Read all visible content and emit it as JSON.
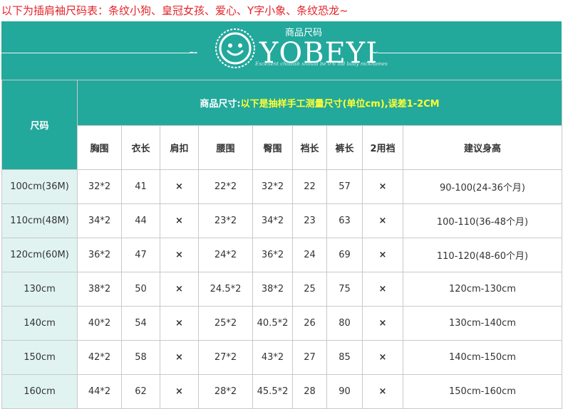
{
  "title": "以下为插肩袖尺码表：条纹小狗、皇冠女孩、爱心、Y字小象、条纹恐龙~",
  "banner": {
    "brand_small": "商品尺码",
    "brand": "YOBEYI",
    "slogan": "Excellent childish should be 0-6 old baby nicknames",
    "logo_icon": "smiley-badge-icon",
    "color": "#23a89c"
  },
  "table": {
    "size_header": "尺码",
    "caption_prefix": "商品尺寸:",
    "caption_note": "以下是抽样手工测量尺寸(单位cm),误差1-2CM",
    "columns": [
      "胸围",
      "衣长",
      "肩扣",
      "腰围",
      "臀围",
      "裆长",
      "裤长",
      "2用裆",
      "建议身高"
    ],
    "x_mark": "×",
    "rows": [
      {
        "size": "100cm(36M)",
        "chest": "32*2",
        "length": "41",
        "waist": "22*2",
        "hip": "32*2",
        "rise": "22",
        "pants": "57",
        "height": "90-100(24-36个月)"
      },
      {
        "size": "110cm(48M)",
        "chest": "34*2",
        "length": "44",
        "waist": "23*2",
        "hip": "34*2",
        "rise": "23",
        "pants": "63",
        "height": "100-110(36-48个月)"
      },
      {
        "size": "120cm(60M)",
        "chest": "36*2",
        "length": "47",
        "waist": "24*2",
        "hip": "36*2",
        "rise": "24",
        "pants": "69",
        "height": "110-120(48-60个月)"
      },
      {
        "size": "130cm",
        "chest": "38*2",
        "length": "50",
        "waist": "24.5*2",
        "hip": "38*2",
        "rise": "25",
        "pants": "75",
        "height": "120cm-130cm"
      },
      {
        "size": "140cm",
        "chest": "40*2",
        "length": "54",
        "waist": "25*2",
        "hip": "40.5*2",
        "rise": "26",
        "pants": "80",
        "height": "130cm-140cm"
      },
      {
        "size": "150cm",
        "chest": "42*2",
        "length": "58",
        "waist": "27*2",
        "hip": "43*2",
        "rise": "27",
        "pants": "85",
        "height": "140cm-150cm"
      },
      {
        "size": "160cm",
        "chest": "44*2",
        "length": "62",
        "waist": "28*2",
        "hip": "45.5*2",
        "rise": "28",
        "pants": "90",
        "height": "150cm-160cm"
      }
    ],
    "colors": {
      "header": "#23a89c",
      "highlight": "#ffff33",
      "mark": "#e4242a",
      "size_col": "#e0f3f1"
    }
  }
}
